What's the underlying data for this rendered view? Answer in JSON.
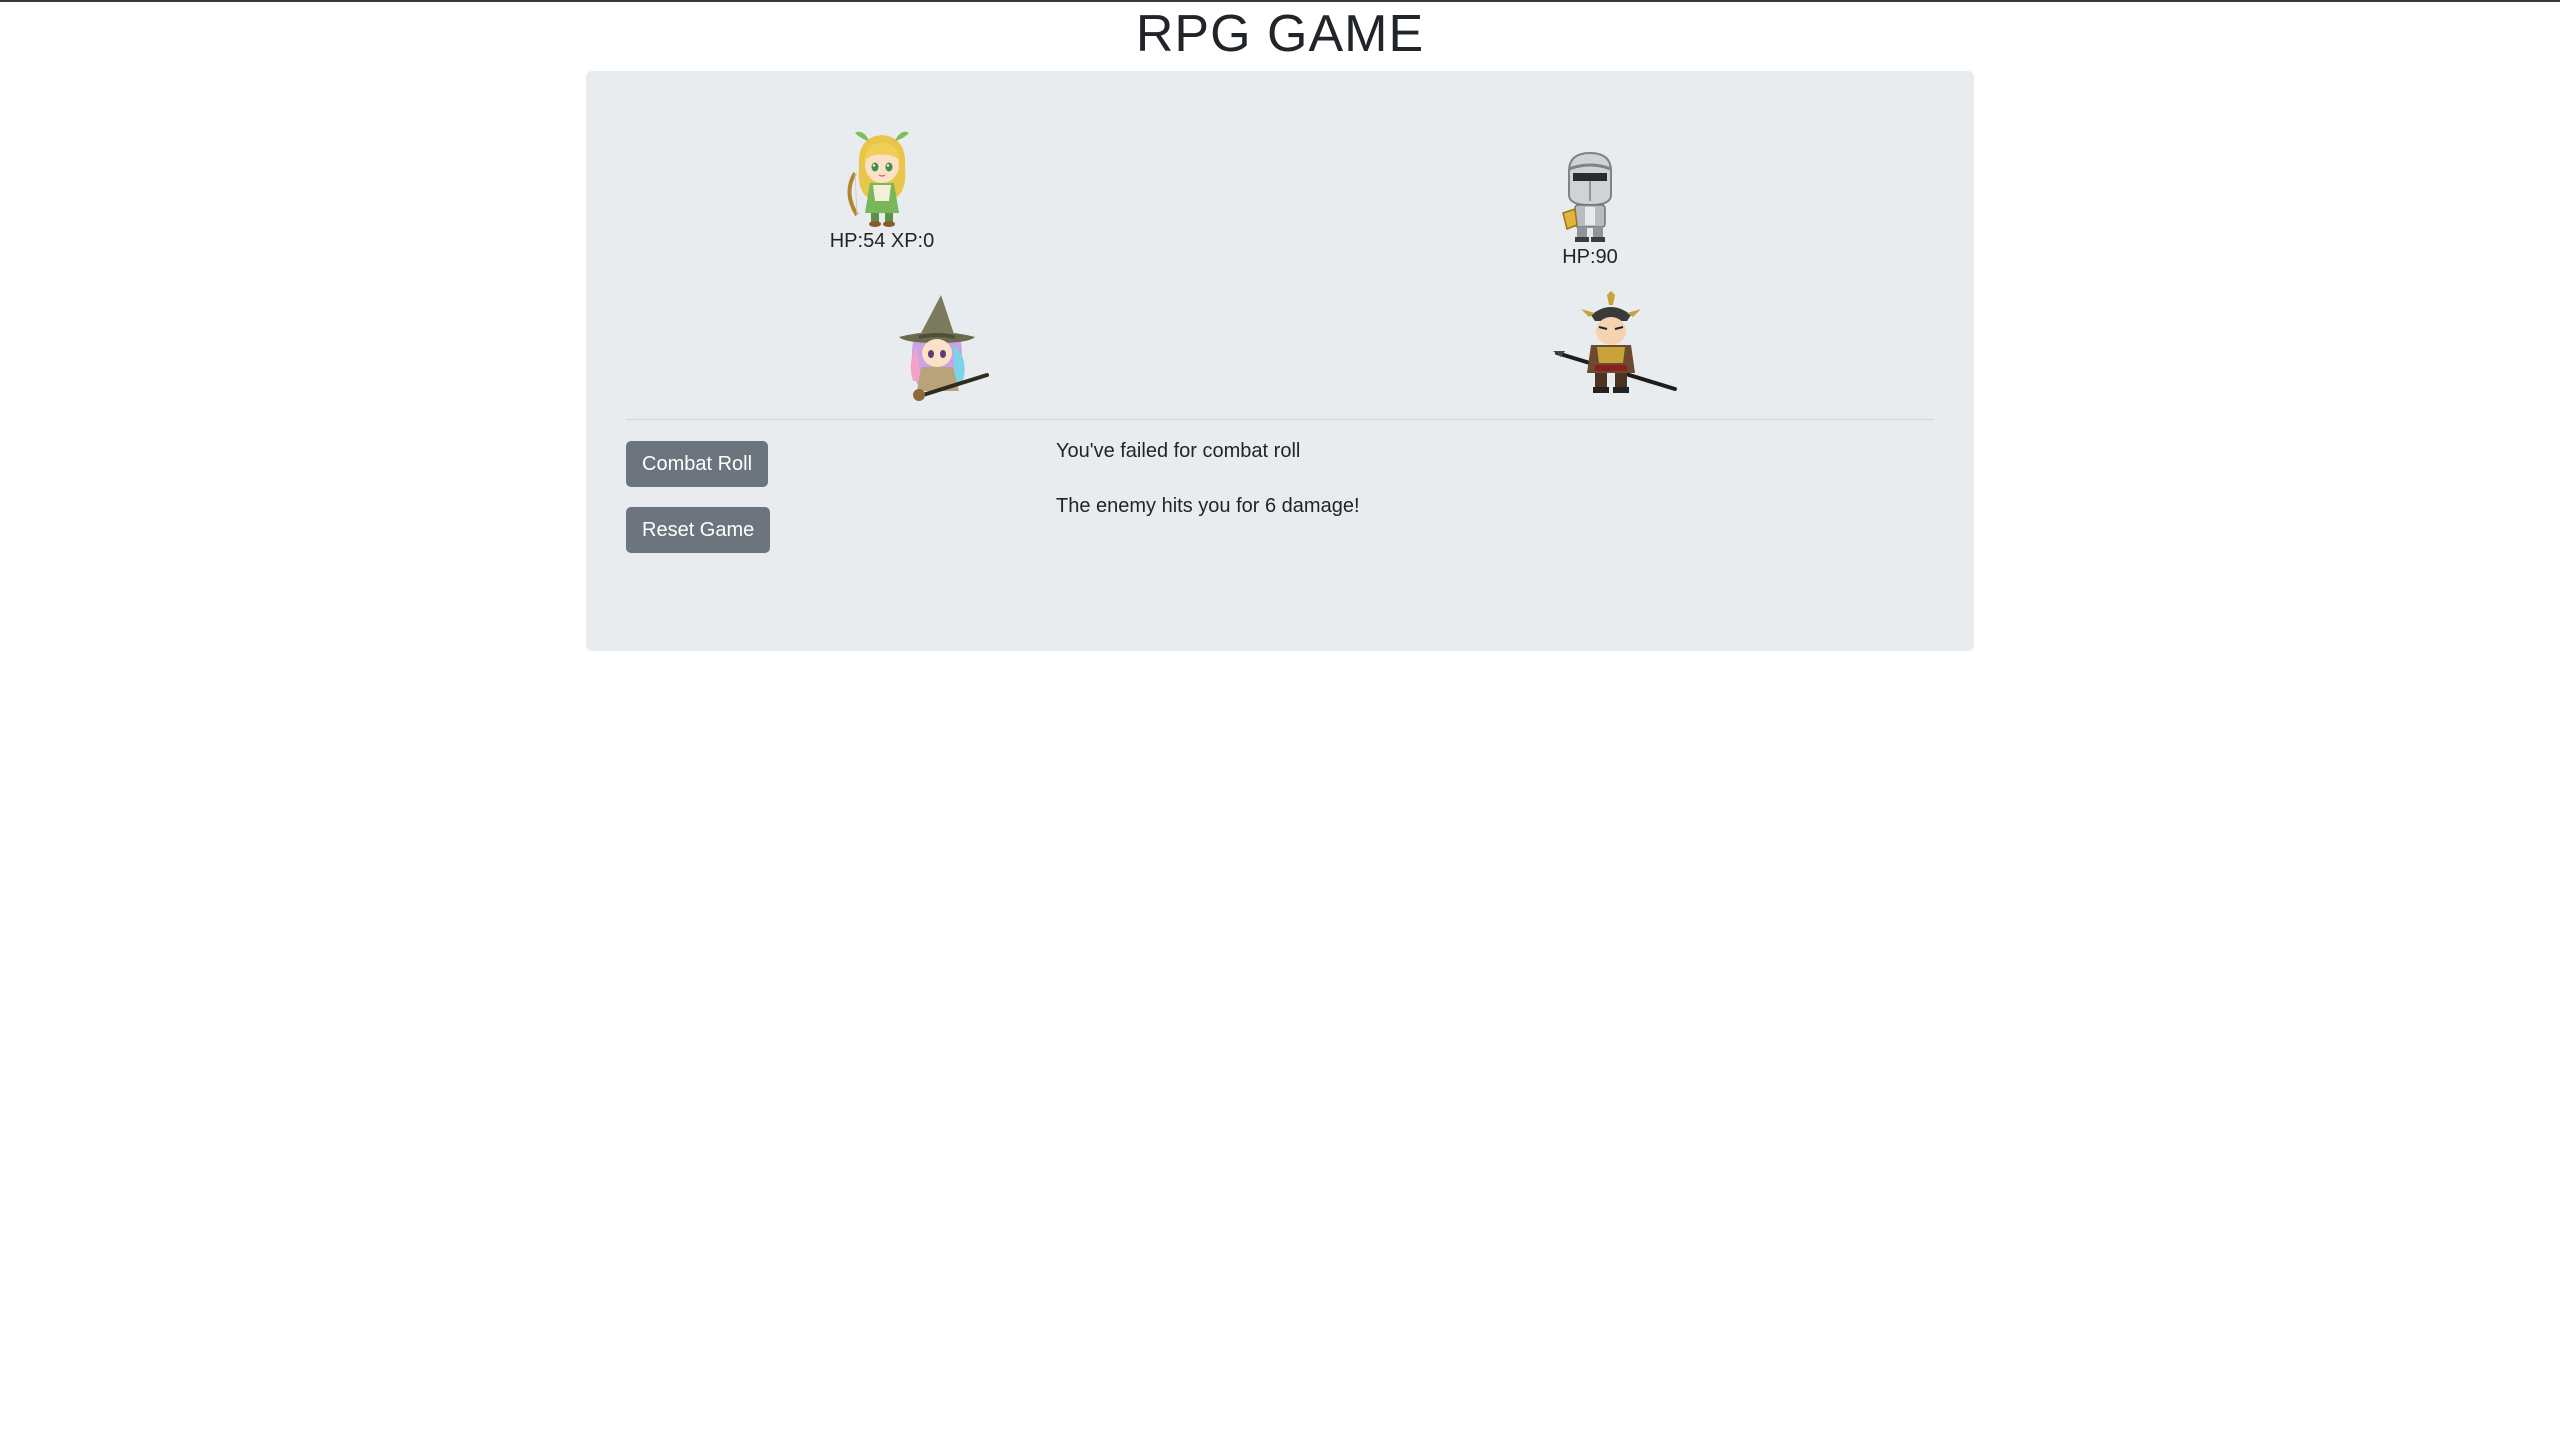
{
  "page": {
    "title": "RPG GAME"
  },
  "player": {
    "stats_label": "HP:54 XP:0"
  },
  "party_member": {},
  "enemy": {
    "stats_label": "HP:90"
  },
  "enemy_ally": {},
  "controls": {
    "combat_roll_label": "Combat Roll",
    "reset_game_label": "Reset Game"
  },
  "log": [
    "You've failed for combat roll",
    "The enemy hits you for 6 damage!"
  ],
  "colors": {
    "panel_bg": "#e9ecef",
    "button_bg": "#6c757d",
    "button_text": "#ffffff",
    "text": "#212529"
  }
}
